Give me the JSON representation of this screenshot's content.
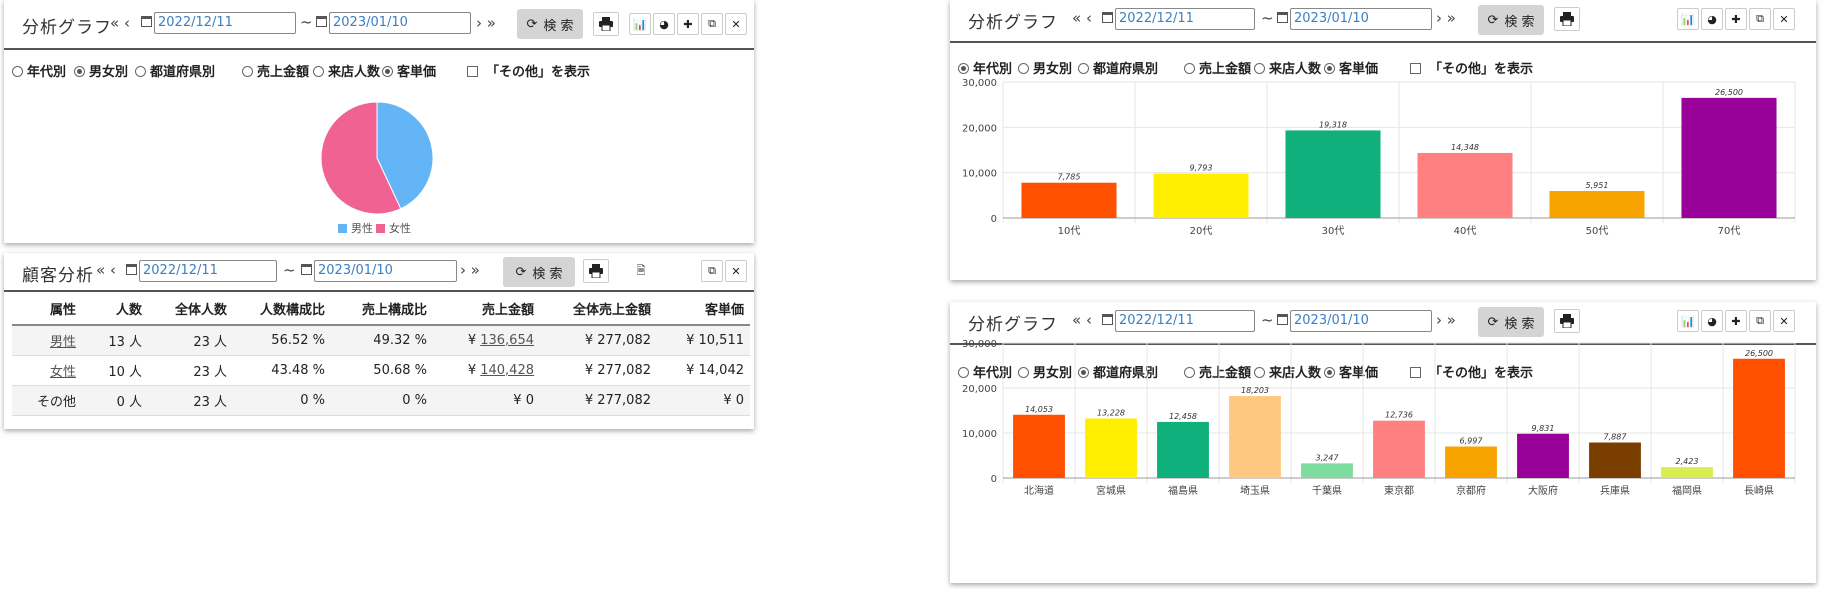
{
  "common": {
    "nav_prev": "« ‹",
    "nav_next": "› »",
    "tilde": "~",
    "search_label": "検 索",
    "yen": "¥",
    "options": {
      "by_age": "年代別",
      "by_gender": "男女別",
      "by_pref": "都道府県別",
      "sales": "売上金額",
      "visitors": "来店人数",
      "unit_price": "客単価",
      "show_other": "「その他」を表示"
    }
  },
  "panel_pie": {
    "title": "分析グラフ",
    "date_from": "2022/12/11",
    "date_to": "2023/01/10",
    "selected_group": "by_gender",
    "selected_metric": "unit_price",
    "chart_data": {
      "type": "pie",
      "slices": [
        {
          "name": "男性",
          "value": 43.03,
          "color": "#64b5f6"
        },
        {
          "name": "女性",
          "value": 56.97,
          "color": "#f06292"
        }
      ]
    }
  },
  "panel_table": {
    "title": "顧客分析",
    "date_from": "2022/12/11",
    "date_to": "2023/01/10",
    "headers": [
      "属性",
      "人数",
      "全体人数",
      "人数構成比",
      "売上構成比",
      "売上金額",
      "全体売上金額",
      "客単価"
    ],
    "rows": [
      {
        "attr": "男性",
        "count": "13 人",
        "total": "23 人",
        "count_ratio": "56.52 %",
        "sales_ratio": "49.32 %",
        "sales": "136,654",
        "total_sales": "¥ 277,082",
        "unit": "¥ 10,511"
      },
      {
        "attr": "女性",
        "count": "10 人",
        "total": "23 人",
        "count_ratio": "43.48 %",
        "sales_ratio": "50.68 %",
        "sales": "140,428",
        "total_sales": "¥ 277,082",
        "unit": "¥ 14,042"
      },
      {
        "attr": "その他",
        "count": "0 人",
        "total": "23 人",
        "count_ratio": "0 %",
        "sales_ratio": "0 %",
        "sales": "0",
        "total_sales": "¥ 277,082",
        "unit": "¥ 0"
      }
    ]
  },
  "panel_age": {
    "title": "分析グラフ",
    "date_from": "2022/12/11",
    "date_to": "2023/01/10",
    "selected_group": "by_age",
    "selected_metric": "unit_price",
    "chart_data": {
      "type": "bar",
      "categories": [
        "10代",
        "20代",
        "30代",
        "40代",
        "50代",
        "70代"
      ],
      "values": [
        7785,
        9793,
        19318,
        14348,
        5951,
        26500
      ],
      "value_labels": [
        "7,785",
        "9,793",
        "19,318",
        "14,348",
        "5,951",
        "26,500"
      ],
      "colors": [
        "#ff5000",
        "#ffee00",
        "#0fb07b",
        "#ff8080",
        "#f7a400",
        "#990099"
      ],
      "yticks": [
        "0",
        "10,000",
        "20,000",
        "30,000"
      ],
      "ylim": [
        0,
        30000
      ]
    }
  },
  "panel_pref": {
    "title": "分析グラフ",
    "date_from": "2022/12/11",
    "date_to": "2023/01/10",
    "selected_group": "by_pref",
    "selected_metric": "unit_price",
    "chart_data": {
      "type": "bar",
      "categories": [
        "北海道",
        "宮城県",
        "福島県",
        "埼玉県",
        "千葉県",
        "東京都",
        "京都府",
        "大阪府",
        "兵庫県",
        "福岡県",
        "長崎県"
      ],
      "values": [
        14053,
        13228,
        12458,
        18203,
        3247,
        12736,
        6997,
        9831,
        7887,
        2423,
        26500
      ],
      "value_labels": [
        "14,053",
        "13,228",
        "12,458",
        "18,203",
        "3,247",
        "12,736",
        "6,997",
        "9,831",
        "7,887",
        "2,423",
        "26,500"
      ],
      "colors": [
        "#ff5000",
        "#ffee00",
        "#0fb07b",
        "#ffc880",
        "#7fdca0",
        "#ff8080",
        "#f7a400",
        "#990099",
        "#7a3f00",
        "#d8ee50",
        "#ff5000"
      ],
      "yticks": [
        "0",
        "10,000",
        "20,000",
        "30,000"
      ],
      "ylim": [
        0,
        30000
      ]
    }
  }
}
